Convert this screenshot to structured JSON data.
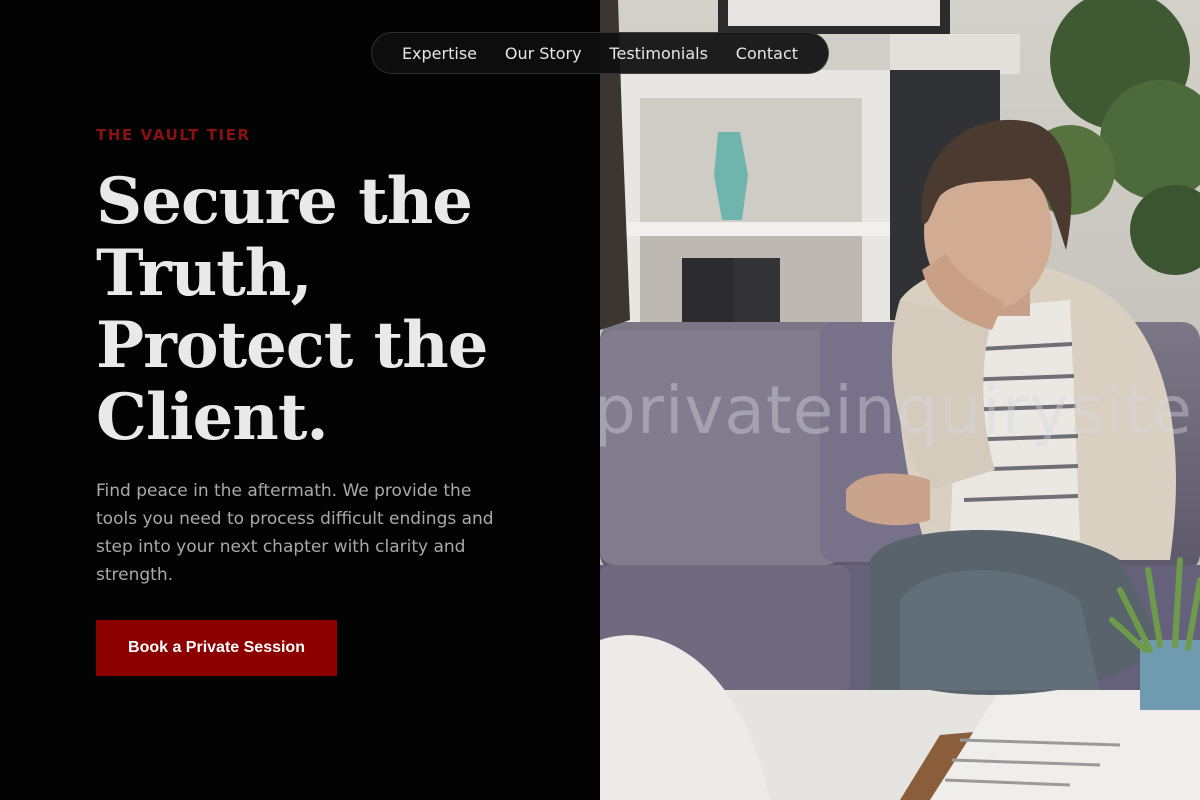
{
  "nav": {
    "items": [
      "Expertise",
      "Our Story",
      "Testimonials",
      "Contact"
    ]
  },
  "hero": {
    "eyebrow": "THE VAULT TIER",
    "headline_lines": [
      "Secure the",
      "Truth,",
      "Protect the",
      "Client."
    ],
    "lede": "Find peace in the aftermath. We provide the tools you need to process difficult endings and step into your next chapter with clarity and strength.",
    "cta_label": "Book a Private Session"
  },
  "photo": {
    "watermark": "privateinquirysite",
    "description_icon": "counseling-session-photo"
  },
  "colors": {
    "background": "#030303",
    "accent": "#8c0000",
    "eyebrow": "#8a1111",
    "headline": "#e9e9e9",
    "body_text": "#a9a9a9"
  }
}
